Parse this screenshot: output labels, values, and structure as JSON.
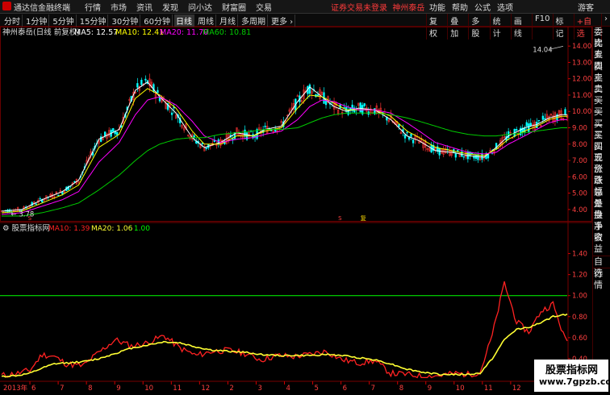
{
  "app": {
    "name": "通达信金融终端",
    "notice": "证券交易未登录",
    "stock_link": "神州泰岳",
    "guest": "游客"
  },
  "menu": [
    "行情",
    "市场",
    "资讯",
    "发现",
    "问小达",
    "财富圈",
    "交易"
  ],
  "right_menu": [
    "功能",
    "帮助",
    "公式",
    "选项"
  ],
  "window_controls": [
    "_",
    "□",
    "×"
  ],
  "periods": [
    {
      "label": "分时",
      "active": false
    },
    {
      "label": "1分钟",
      "active": false
    },
    {
      "label": "5分钟",
      "active": false
    },
    {
      "label": "15分钟",
      "active": false
    },
    {
      "label": "30分钟",
      "active": false
    },
    {
      "label": "60分钟",
      "active": false
    },
    {
      "label": "日线",
      "active": true
    },
    {
      "label": "周线",
      "active": false
    },
    {
      "label": "月线",
      "active": false
    },
    {
      "label": "多周期",
      "active": false
    },
    {
      "label": "更多 ›",
      "active": false
    }
  ],
  "toolbar_right": [
    {
      "label": "复权",
      "hl": false
    },
    {
      "label": "叠加",
      "hl": false
    },
    {
      "label": "多股",
      "hl": false
    },
    {
      "label": "统计",
      "hl": false
    },
    {
      "label": "画线",
      "hl": false
    },
    {
      "label": "F10",
      "hl": false
    },
    {
      "label": "标记",
      "hl": false
    },
    {
      "label": "+自选",
      "hl": true
    },
    {
      "label": "›",
      "hl": false
    }
  ],
  "main_legend": {
    "stock": "神州泰岳(日线 前复权)",
    "ma5": "MA5: 12.57",
    "ma10": "MA10: 12.41",
    "ma20": "MA20: 11.70",
    "ma60": "MA60: 10.81"
  },
  "colors": {
    "ma5": "#ffffff",
    "ma10": "#ffff00",
    "ma20": "#ff00ff",
    "ma60": "#00cc00",
    "up": "#ff3333",
    "down": "#00ffff",
    "red_line": "#ff2222",
    "yellow_line": "#ffff33",
    "green_line": "#00ff00"
  },
  "chart_data": [
    {
      "type": "line",
      "title": "神州泰岳(日线 前复权)",
      "yticks": [
        4.0,
        5.0,
        6.0,
        7.0,
        8.0,
        9.0,
        10.0,
        11.0,
        12.0,
        13.0,
        14.0
      ],
      "ylim": [
        3.5,
        14.6
      ],
      "annotations": {
        "high": "14.04",
        "low": "3.78"
      },
      "x_days": 280,
      "series": [
        {
          "name": "MA5",
          "anchors": [
            [
              0,
              3.9
            ],
            [
              10,
              4.0
            ],
            [
              20,
              4.6
            ],
            [
              30,
              5.1
            ],
            [
              38,
              5.8
            ],
            [
              48,
              8.3
            ],
            [
              58,
              8.9
            ],
            [
              66,
              11.3
            ],
            [
              72,
              11.8
            ],
            [
              78,
              10.9
            ],
            [
              86,
              9.9
            ],
            [
              94,
              8.4
            ],
            [
              100,
              7.8
            ],
            [
              108,
              8.1
            ],
            [
              116,
              8.7
            ],
            [
              124,
              8.5
            ],
            [
              130,
              8.9
            ],
            [
              138,
              9.1
            ],
            [
              146,
              10.6
            ],
            [
              152,
              11.5
            ],
            [
              158,
              10.9
            ],
            [
              164,
              10.3
            ],
            [
              170,
              10.0
            ],
            [
              176,
              10.2
            ],
            [
              184,
              10.1
            ],
            [
              192,
              9.5
            ],
            [
              200,
              8.5
            ],
            [
              206,
              8.2
            ],
            [
              214,
              7.6
            ],
            [
              222,
              7.5
            ],
            [
              230,
              7.3
            ],
            [
              238,
              7.2
            ],
            [
              244,
              7.8
            ],
            [
              250,
              8.5
            ],
            [
              258,
              9.0
            ],
            [
              264,
              9.2
            ],
            [
              270,
              9.6
            ],
            [
              276,
              9.8
            ]
          ]
        },
        {
          "name": "MA10",
          "anchors": [
            [
              0,
              3.8
            ],
            [
              10,
              3.9
            ],
            [
              20,
              4.4
            ],
            [
              30,
              4.9
            ],
            [
              38,
              5.5
            ],
            [
              48,
              7.8
            ],
            [
              58,
              8.6
            ],
            [
              66,
              10.8
            ],
            [
              72,
              11.4
            ],
            [
              78,
              11.0
            ],
            [
              86,
              10.2
            ],
            [
              94,
              8.8
            ],
            [
              100,
              8.0
            ],
            [
              108,
              8.0
            ],
            [
              116,
              8.5
            ],
            [
              124,
              8.5
            ],
            [
              130,
              8.8
            ],
            [
              138,
              9.0
            ],
            [
              146,
              10.2
            ],
            [
              152,
              11.0
            ],
            [
              158,
              10.9
            ],
            [
              164,
              10.5
            ],
            [
              170,
              10.1
            ],
            [
              176,
              10.1
            ],
            [
              184,
              10.1
            ],
            [
              192,
              9.7
            ],
            [
              200,
              8.8
            ],
            [
              206,
              8.4
            ],
            [
              214,
              7.8
            ],
            [
              222,
              7.6
            ],
            [
              230,
              7.4
            ],
            [
              238,
              7.3
            ],
            [
              244,
              7.7
            ],
            [
              250,
              8.3
            ],
            [
              258,
              8.8
            ],
            [
              264,
              9.1
            ],
            [
              270,
              9.5
            ],
            [
              276,
              9.7
            ]
          ]
        },
        {
          "name": "MA20",
          "anchors": [
            [
              0,
              3.7
            ],
            [
              10,
              3.8
            ],
            [
              20,
              4.2
            ],
            [
              30,
              4.6
            ],
            [
              38,
              5.1
            ],
            [
              48,
              6.9
            ],
            [
              58,
              8.1
            ],
            [
              66,
              9.8
            ],
            [
              72,
              10.7
            ],
            [
              78,
              10.9
            ],
            [
              86,
              10.4
            ],
            [
              94,
              9.4
            ],
            [
              100,
              8.5
            ],
            [
              108,
              8.1
            ],
            [
              116,
              8.3
            ],
            [
              124,
              8.4
            ],
            [
              130,
              8.6
            ],
            [
              138,
              8.8
            ],
            [
              146,
              9.5
            ],
            [
              152,
              10.3
            ],
            [
              158,
              10.7
            ],
            [
              164,
              10.6
            ],
            [
              170,
              10.3
            ],
            [
              176,
              10.1
            ],
            [
              184,
              10.1
            ],
            [
              192,
              9.9
            ],
            [
              200,
              9.3
            ],
            [
              206,
              8.8
            ],
            [
              214,
              8.1
            ],
            [
              222,
              7.8
            ],
            [
              230,
              7.5
            ],
            [
              238,
              7.4
            ],
            [
              244,
              7.5
            ],
            [
              250,
              8.0
            ],
            [
              258,
              8.5
            ],
            [
              264,
              8.9
            ],
            [
              270,
              9.3
            ],
            [
              276,
              9.5
            ]
          ]
        },
        {
          "name": "MA60",
          "anchors": [
            [
              0,
              3.6
            ],
            [
              10,
              3.6
            ],
            [
              20,
              3.8
            ],
            [
              30,
              4.1
            ],
            [
              38,
              4.4
            ],
            [
              48,
              5.2
            ],
            [
              58,
              6.1
            ],
            [
              66,
              7.0
            ],
            [
              72,
              7.6
            ],
            [
              78,
              8.0
            ],
            [
              86,
              8.3
            ],
            [
              94,
              8.4
            ],
            [
              100,
              8.4
            ],
            [
              108,
              8.6
            ],
            [
              116,
              8.7
            ],
            [
              124,
              8.8
            ],
            [
              130,
              8.9
            ],
            [
              138,
              8.9
            ],
            [
              146,
              9.0
            ],
            [
              152,
              9.3
            ],
            [
              158,
              9.6
            ],
            [
              164,
              9.8
            ],
            [
              170,
              9.9
            ],
            [
              176,
              9.9
            ],
            [
              184,
              9.9
            ],
            [
              192,
              9.8
            ],
            [
              200,
              9.6
            ],
            [
              206,
              9.4
            ],
            [
              214,
              9.1
            ],
            [
              222,
              8.8
            ],
            [
              230,
              8.6
            ],
            [
              238,
              8.5
            ],
            [
              244,
              8.5
            ],
            [
              250,
              8.6
            ],
            [
              258,
              8.7
            ],
            [
              264,
              8.8
            ],
            [
              270,
              8.9
            ],
            [
              276,
              9.0
            ]
          ]
        }
      ]
    },
    {
      "type": "line",
      "title": "股票指标网",
      "legend": {
        "ma10": "MA10: 1.39",
        "ma20": "MA20: 1.06",
        "ref": ": 1.00"
      },
      "yticks": [
        0.4,
        0.6,
        0.8,
        1.0,
        1.2,
        1.4
      ],
      "ylim": [
        0.2,
        1.55
      ],
      "reference": 1.0,
      "series": [
        {
          "name": "MA10",
          "anchors": [
            [
              0,
              0.24
            ],
            [
              8,
              0.26
            ],
            [
              14,
              0.29
            ],
            [
              20,
              0.44
            ],
            [
              26,
              0.42
            ],
            [
              32,
              0.35
            ],
            [
              40,
              0.33
            ],
            [
              48,
              0.46
            ],
            [
              56,
              0.58
            ],
            [
              64,
              0.52
            ],
            [
              72,
              0.55
            ],
            [
              80,
              0.62
            ],
            [
              88,
              0.5
            ],
            [
              96,
              0.43
            ],
            [
              104,
              0.47
            ],
            [
              112,
              0.48
            ],
            [
              120,
              0.45
            ],
            [
              128,
              0.39
            ],
            [
              136,
              0.43
            ],
            [
              144,
              0.42
            ],
            [
              152,
              0.44
            ],
            [
              160,
              0.47
            ],
            [
              168,
              0.39
            ],
            [
              176,
              0.36
            ],
            [
              184,
              0.38
            ],
            [
              192,
              0.26
            ],
            [
              200,
              0.25
            ],
            [
              208,
              0.23
            ],
            [
              216,
              0.24
            ],
            [
              224,
              0.26
            ],
            [
              230,
              0.25
            ],
            [
              236,
              0.27
            ],
            [
              242,
              0.62
            ],
            [
              248,
              1.12
            ],
            [
              254,
              0.75
            ],
            [
              260,
              0.65
            ],
            [
              266,
              0.85
            ],
            [
              272,
              0.92
            ],
            [
              278,
              0.58
            ]
          ]
        },
        {
          "name": "MA20",
          "anchors": [
            [
              0,
              0.23
            ],
            [
              8,
              0.24
            ],
            [
              14,
              0.26
            ],
            [
              20,
              0.31
            ],
            [
              26,
              0.35
            ],
            [
              32,
              0.36
            ],
            [
              40,
              0.37
            ],
            [
              48,
              0.4
            ],
            [
              56,
              0.45
            ],
            [
              64,
              0.5
            ],
            [
              72,
              0.53
            ],
            [
              80,
              0.56
            ],
            [
              88,
              0.55
            ],
            [
              96,
              0.51
            ],
            [
              104,
              0.48
            ],
            [
              112,
              0.47
            ],
            [
              120,
              0.46
            ],
            [
              128,
              0.44
            ],
            [
              136,
              0.43
            ],
            [
              144,
              0.43
            ],
            [
              152,
              0.43
            ],
            [
              160,
              0.44
            ],
            [
              168,
              0.43
            ],
            [
              176,
              0.41
            ],
            [
              184,
              0.39
            ],
            [
              192,
              0.35
            ],
            [
              200,
              0.3
            ],
            [
              208,
              0.27
            ],
            [
              216,
              0.25
            ],
            [
              224,
              0.25
            ],
            [
              230,
              0.25
            ],
            [
              236,
              0.26
            ],
            [
              242,
              0.4
            ],
            [
              248,
              0.58
            ],
            [
              254,
              0.68
            ],
            [
              260,
              0.7
            ],
            [
              266,
              0.74
            ],
            [
              272,
              0.8
            ],
            [
              278,
              0.82
            ]
          ]
        }
      ]
    }
  ],
  "x_axis": [
    "2013年",
    "6",
    "7",
    "8",
    "9",
    "10",
    "11",
    "12",
    "2",
    "3",
    "4",
    "5",
    "6",
    "7",
    "8",
    "9",
    "10",
    "11",
    "12",
    "1"
  ],
  "sidebar": [
    "委比",
    "卖五",
    "卖四",
    "卖三",
    "卖二",
    "卖一",
    "买一",
    "买二",
    "买三",
    "买四",
    "买五",
    "现价",
    "涨跌",
    "涨幅",
    "总量",
    "外盘",
    "换手",
    "净资",
    "收益",
    "",
    "自选",
    "行情"
  ],
  "markers": {
    "s_label": "S",
    "b_label": "B",
    "mid_label": "复"
  },
  "watermark": {
    "line1": "股票指标网",
    "line2": "www.7gpzb.com"
  }
}
